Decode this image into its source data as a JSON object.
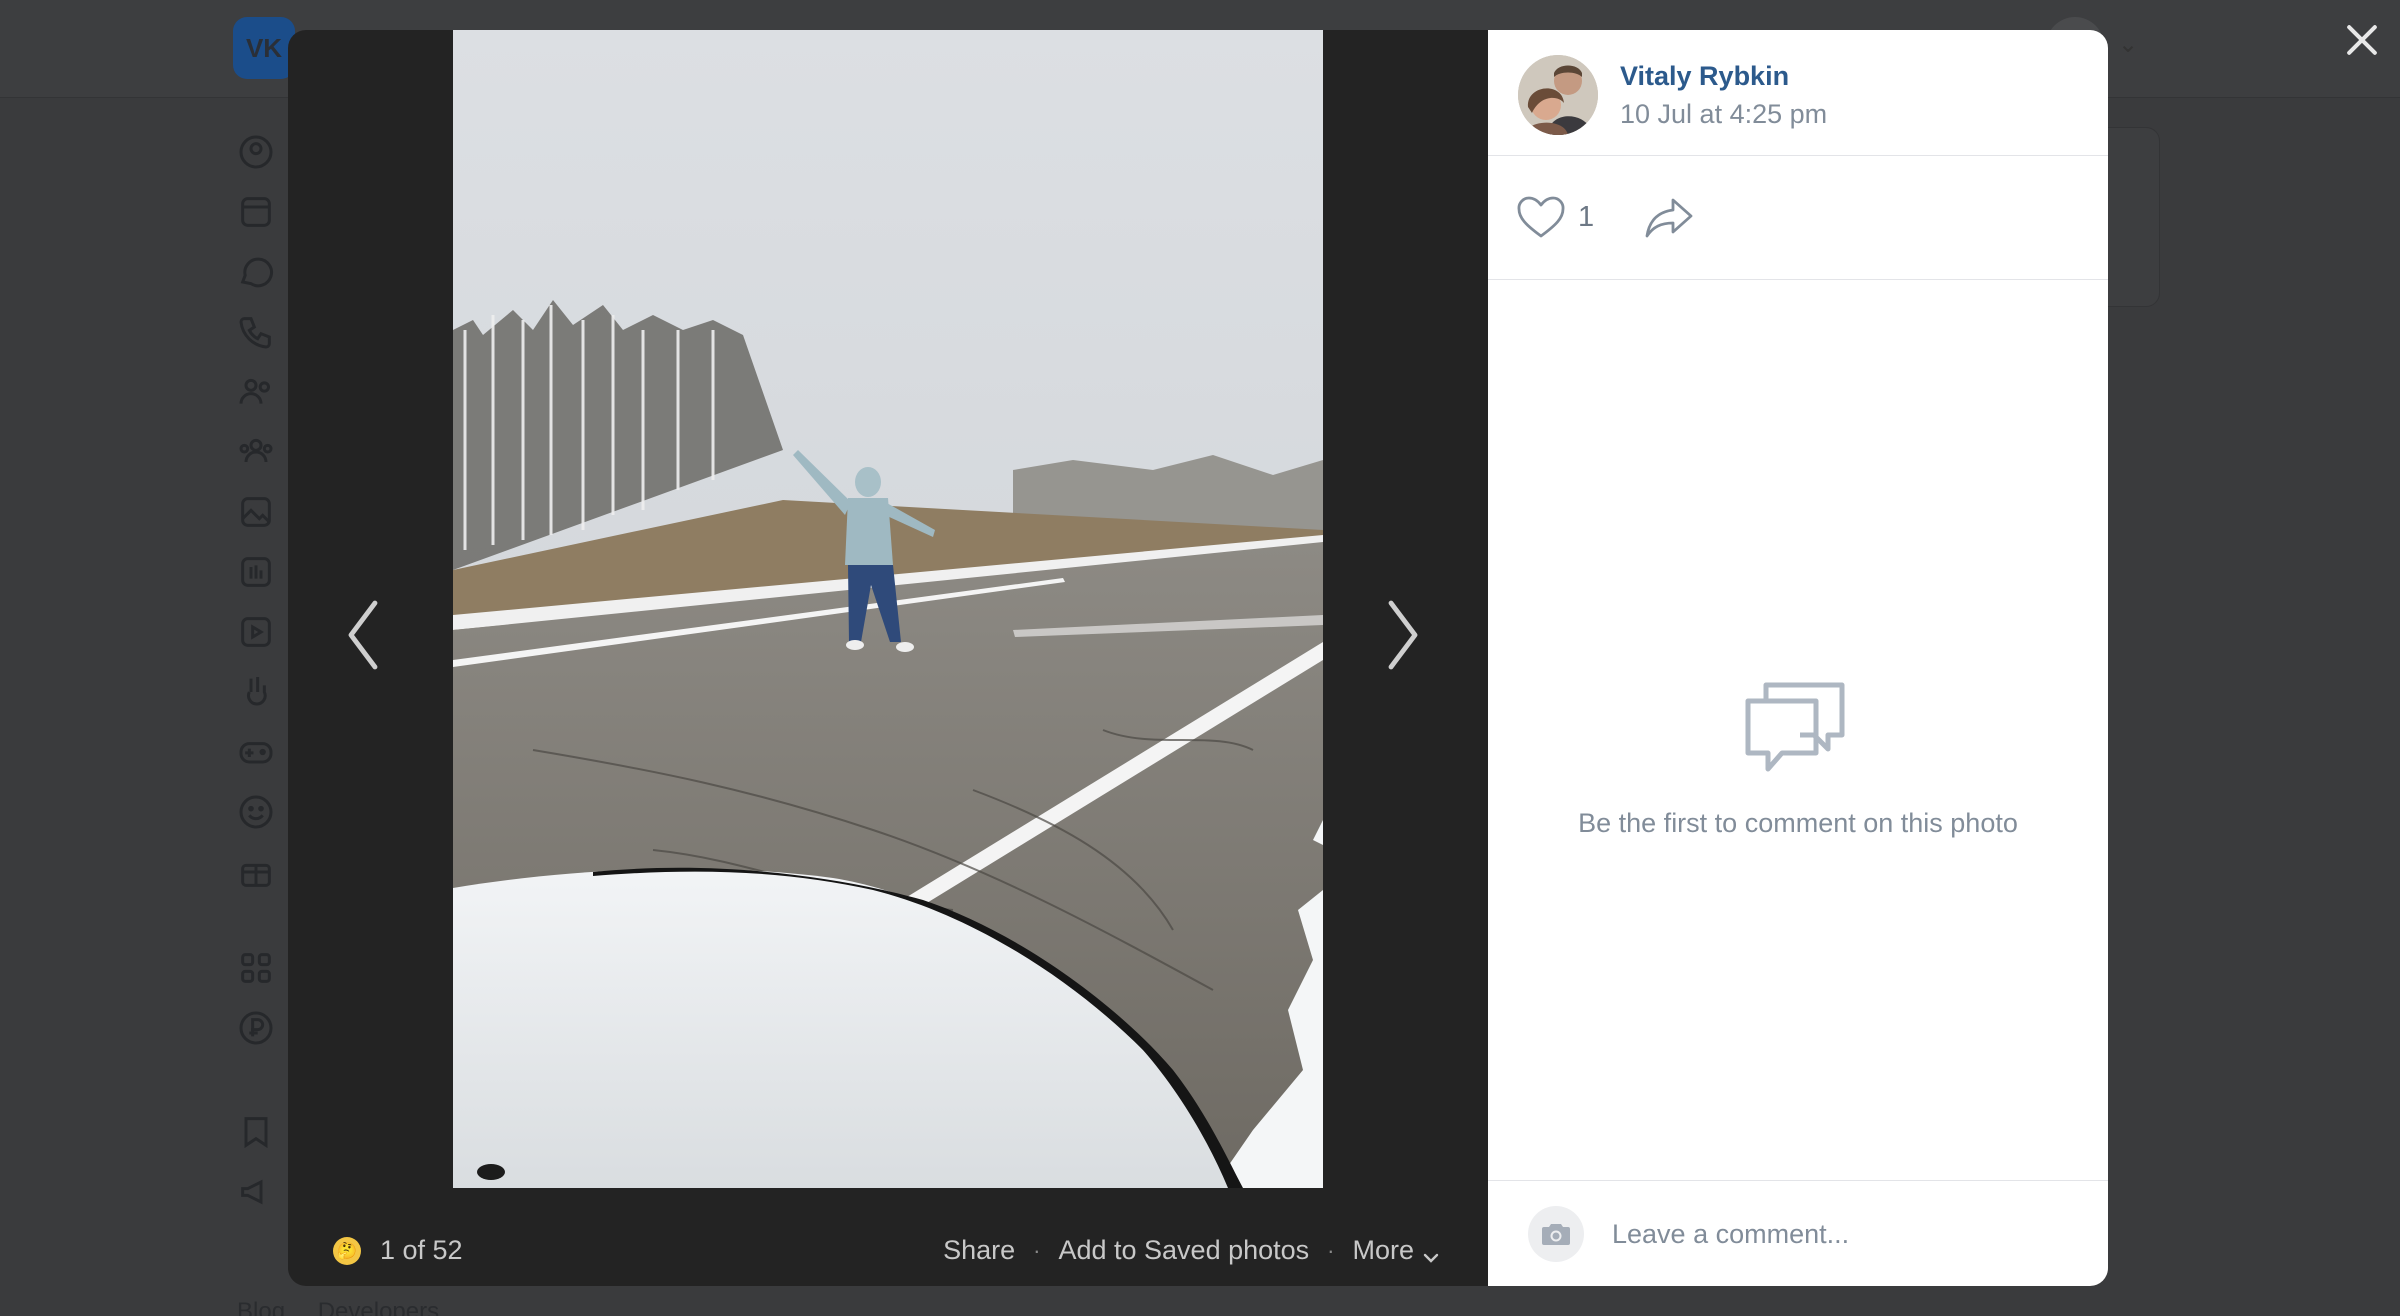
{
  "background": {
    "logo_text": "VK",
    "footer_links": [
      "Blog",
      "Developers"
    ],
    "sidebar_icons": [
      "profile-icon",
      "news-icon",
      "messenger-icon",
      "calls-icon",
      "friends-icon",
      "communities-icon",
      "photos-icon",
      "music-icon",
      "videos-icon",
      "clips-icon",
      "games-icon",
      "stickers-icon",
      "gifts-icon",
      "apps-icon",
      "vk-pay-icon",
      "bookmarks-icon",
      "ads-icon"
    ]
  },
  "viewer": {
    "counter": "1 of 52",
    "emoji": "🤔",
    "actions": {
      "share": "Share",
      "save": "Add to Saved photos",
      "more": "More"
    }
  },
  "panel": {
    "author_name": "Vitaly Rybkin",
    "post_date": "10 Jul at 4:25 pm",
    "like_count": "1",
    "empty_comments": "Be the first to comment on this photo",
    "comment_placeholder": "Leave a comment..."
  },
  "colors": {
    "author_link": "#2c5a8c",
    "muted_text": "#818c99",
    "stage_bg": "#232323",
    "overlay_bg": "#3a3b3d"
  }
}
